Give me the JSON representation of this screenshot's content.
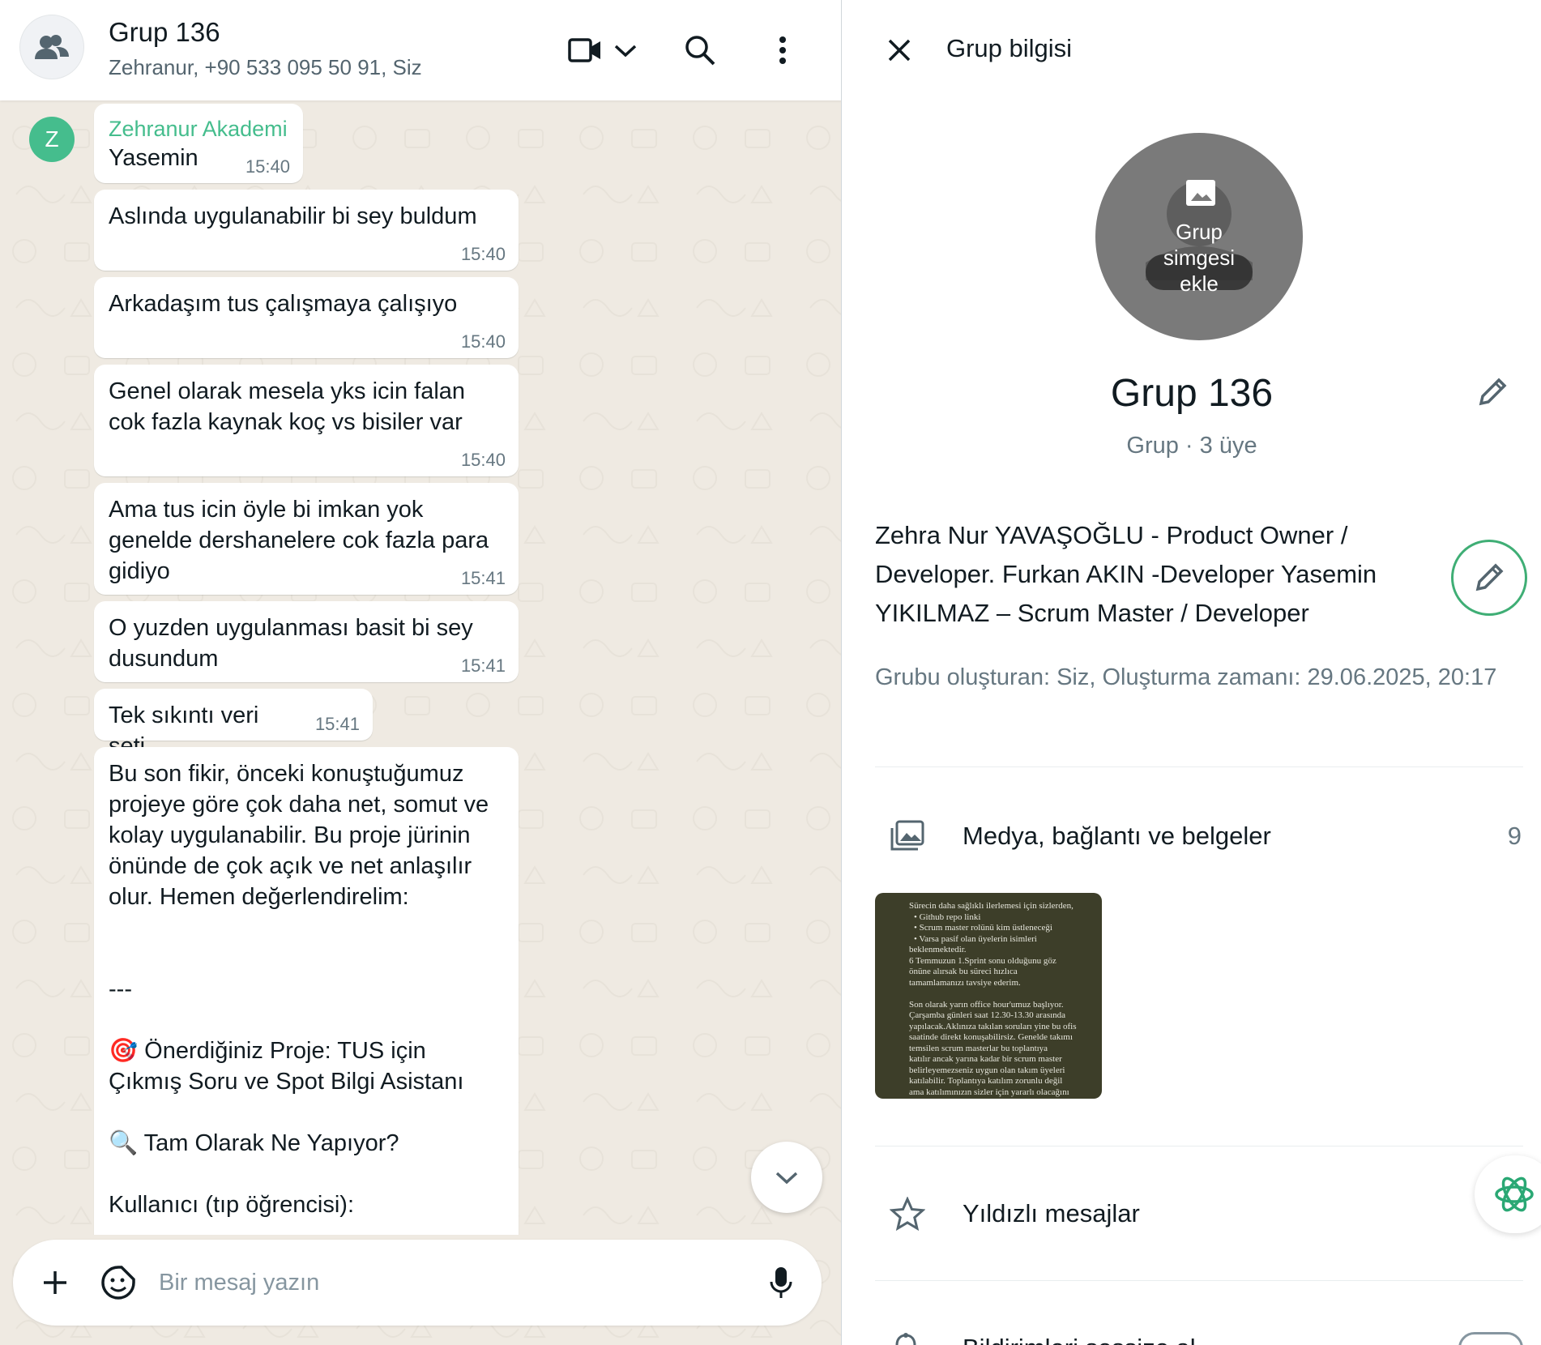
{
  "chat": {
    "header": {
      "title": "Grup 136",
      "subtitle": "Zehranur, +90 533 095 50 91, Siz",
      "icons": [
        "group-avatar-icon",
        "video-call-icon",
        "chevron-down-icon",
        "search-icon",
        "menu-icon"
      ]
    },
    "sender_initial": "Z",
    "messages": [
      {
        "sender": "Zehranur Akademi",
        "text": "Yasemin",
        "time": "15:40"
      },
      {
        "text": "Aslında uygulanabilir bi sey buldum",
        "time": "15:40"
      },
      {
        "text": "Arkadaşım tus çalışmaya çalışıyo",
        "time": "15:40"
      },
      {
        "text": "Genel olarak mesela yks icin falan\ncok fazla kaynak koç vs bisiler var",
        "time": "15:40"
      },
      {
        "text": "Ama tus icin öyle bi imkan yok\ngenelde dershanelere cok fazla para\ngidiyo",
        "time": "15:41"
      },
      {
        "text": "O yuzden uygulanması basit bi sey\ndusundum",
        "time": "15:41"
      },
      {
        "text": "Tek sıkıntı veri seti",
        "time": "15:41"
      },
      {
        "text": "Bu son fikir, önceki konuştuğumuz\nprojeye göre çok daha net, somut ve\nkolay uygulanabilir. Bu proje jürinin\nönünde de çok açık ve net anlaşılır\nolur. Hemen değerlendirelim:\n\n\n---\n\n🎯 Önerdiğiniz Proje: TUS için\nÇıkmış Soru ve Spot Bilgi Asistanı\n\n🔍 Tam Olarak Ne Yapıyor?\n\nKullanıcı (tıp öğrencisi):"
      }
    ],
    "composer": {
      "placeholder": "Bir mesaj yazın"
    }
  },
  "info": {
    "title": "Grup bilgisi",
    "photo_label": "Grup\nsimgesi\nekle",
    "group_name": "Grup 136",
    "meta": "Grup · 3 üye",
    "description": "Zehra Nur YAVAŞOĞLU - Product Owner / Developer. Furkan AKIN -Developer Yasemin YIKILMAZ – Scrum Master / Developer",
    "created": "Grubu oluşturan: Siz, Oluşturma zamanı: 29.06.2025, 20:17",
    "media": {
      "label": "Medya, bağlantı ve belgeler",
      "count": "9",
      "thumb_lines": [
        "Sürecin daha sağlıklı ilerlemesi için sizlerden,",
        "•  Github repo linki",
        "•  Scrum master rolünü kim üstleneceği",
        "•  Varsa pasif olan üyelerin isimleri",
        "beklenmektedir.",
        "6 Temmuzun 1.Sprint sonu olduğunu göz",
        "önüne alırsak bu süreci hızlıca",
        "tamamlamanızı tavsiye ederim.",
        "",
        "Son olarak yarın office hour'umuz başlıyor.",
        "Çarşamba günleri saat 12.30-13.30 arasında",
        "yapılacak.Aklınıza takılan soruları yine bu ofis",
        "saatinde direkt konuşabilirsiz. Genelde takımı",
        "temsilen scrum masterlar bu toplantıya",
        "katılır ancak yarına kadar bir scrum master",
        "belirleyemezseniz uygun olan takım üyeleri",
        "katılabilir. Toplantıya katılım zorunlu değil",
        "ama katılımınızın sizler için yararlı olacağını"
      ]
    },
    "starred": {
      "label": "Yıldızlı mesajlar"
    },
    "notifications": {
      "label": "Bildirimleri sessize al"
    }
  },
  "colors": {
    "accent": "#45bd8d",
    "edit_ring": "#3fae75",
    "chat_bg": "#efeae2"
  }
}
